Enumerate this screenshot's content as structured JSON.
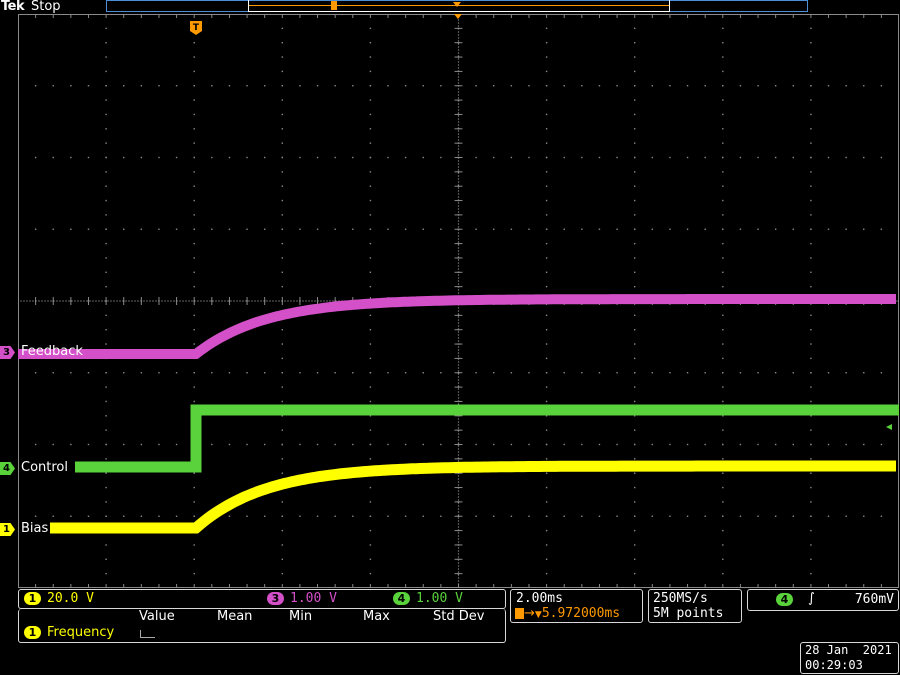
{
  "header": {
    "brand": "Tek",
    "state": "Stop"
  },
  "colors": {
    "ch1": "#ffff00",
    "ch3": "#d450c9",
    "ch4": "#59d23b",
    "trigger": "#ff9900",
    "border": "#d8d8d8",
    "grid": "#8a8a8a"
  },
  "channels": [
    {
      "number": "1",
      "name": "Bias",
      "color": "#ffff00"
    },
    {
      "number": "3",
      "name": "Feedback",
      "color": "#d450c9"
    },
    {
      "number": "4",
      "name": "Control",
      "color": "#59d23b"
    }
  ],
  "trigger_marker": "T",
  "vertical_settings": {
    "ch1": {
      "number": "1",
      "scale": "20.0 V"
    },
    "ch3": {
      "number": "3",
      "scale": "1.00 V"
    },
    "ch4": {
      "number": "4",
      "scale": "1.00 V"
    }
  },
  "measurements": {
    "columns": [
      "Value",
      "Mean",
      "Min",
      "Max",
      "Std Dev"
    ],
    "row": {
      "channel": "1",
      "name": "Frequency",
      "value": ""
    }
  },
  "horizontal": {
    "time_scale": "2.00ms",
    "trigger_position": "5.972000ms"
  },
  "acquisition": {
    "sample_rate": "250MS/s",
    "record_length": "5M points"
  },
  "trigger_settings": {
    "source": "4",
    "slope": "rising",
    "level": "760mV"
  },
  "datetime": {
    "date": "28 Jan  2021",
    "time": "00:29:03"
  }
}
